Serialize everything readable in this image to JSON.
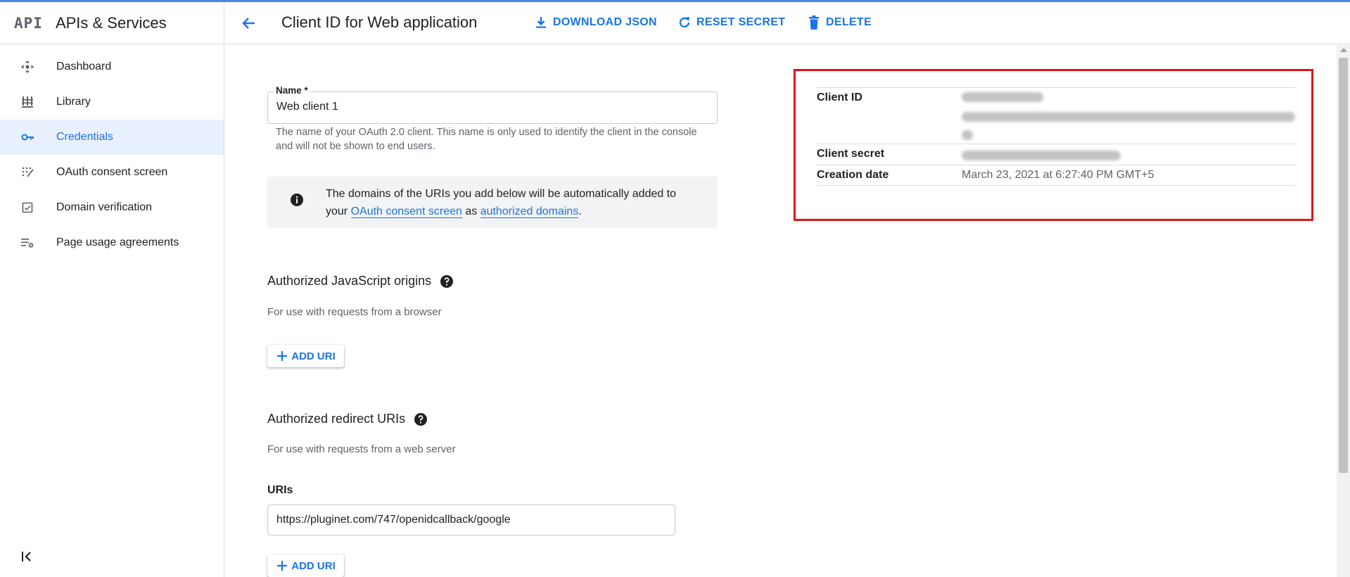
{
  "app": {
    "logo": "API",
    "title": "APIs & Services"
  },
  "sidebar": {
    "items": [
      {
        "label": "Dashboard",
        "icon": "dashboard-icon"
      },
      {
        "label": "Library",
        "icon": "library-icon"
      },
      {
        "label": "Credentials",
        "icon": "key-icon",
        "active": true
      },
      {
        "label": "OAuth consent screen",
        "icon": "consent-icon"
      },
      {
        "label": "Domain verification",
        "icon": "checkbox-icon"
      },
      {
        "label": "Page usage agreements",
        "icon": "settings-list-icon"
      }
    ],
    "collapse_icon": "collapse-sidebar-icon"
  },
  "header": {
    "title": "Client ID for Web application",
    "download_label": "DOWNLOAD JSON",
    "reset_label": "RESET SECRET",
    "delete_label": "DELETE"
  },
  "form": {
    "name_label": "Name *",
    "name_value": "Web client 1",
    "name_hint": "The name of your OAuth 2.0 client. This name is only used to identify the client in the console and will not be shown to end users.",
    "info": {
      "text_before": "The domains of the URIs you add below will be automatically added to your ",
      "link1": "OAuth consent screen",
      "text_middle": " as ",
      "link2": "authorized domains",
      "text_after": "."
    },
    "js_origins": {
      "title": "Authorized JavaScript origins",
      "subtitle": "For use with requests from a browser",
      "add_label": "ADD URI"
    },
    "redirect_uris": {
      "title": "Authorized redirect URIs",
      "subtitle": "For use with requests from a web server",
      "uris_label": "URIs",
      "uri_value": "https://pluginet.com/747/openidcallback/google",
      "add_label": "ADD URI"
    }
  },
  "client_details": {
    "client_id_label": "Client ID",
    "client_secret_label": "Client secret",
    "creation_date_label": "Creation date",
    "creation_date_value": "March 23, 2021 at 6:27:40 PM GMT+5",
    "highlight_color": "#e0131b"
  },
  "colors": {
    "accent": "#1a73e8",
    "active_bg": "#e8f0fe",
    "topline": "#4a86e8"
  }
}
